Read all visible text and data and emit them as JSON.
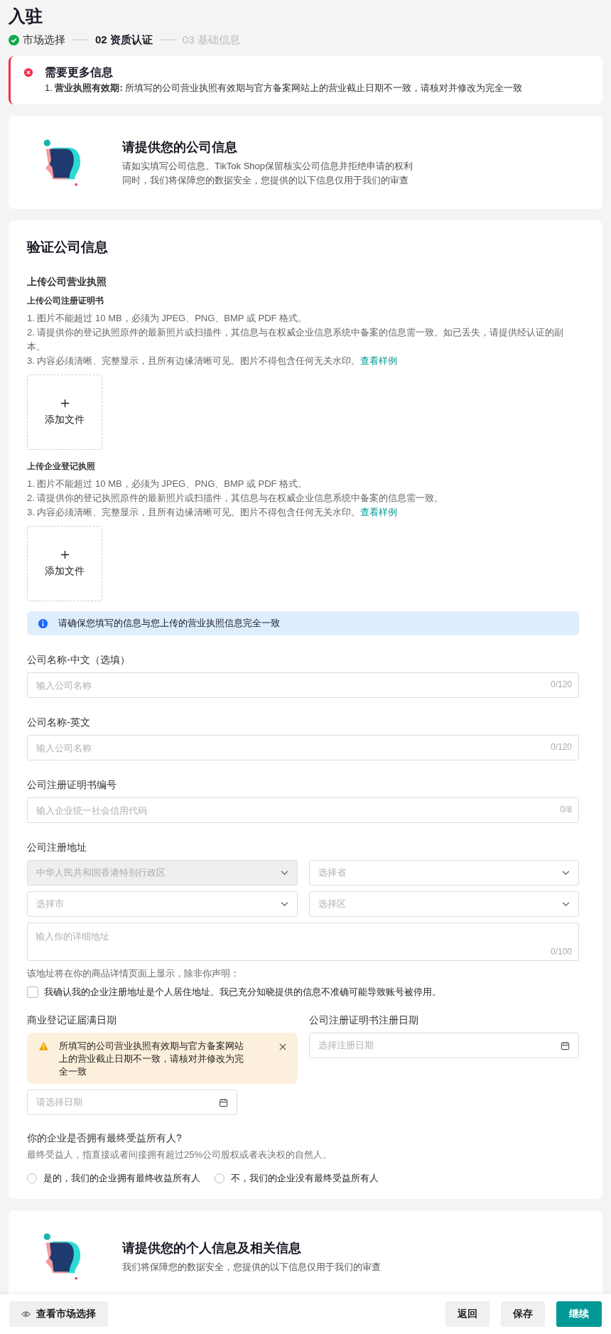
{
  "page_title": "入驻",
  "steps": [
    {
      "label": "市场选择",
      "completed": true,
      "selected": false
    },
    {
      "label": "02 资质认证",
      "completed": false,
      "selected": true
    },
    {
      "label": "03 基础信息",
      "completed": false,
      "selected": false
    }
  ],
  "alert": {
    "title": "需要更多信息",
    "text": "1. **营业执照有效期:** 所填写的公司营业执照有效期与官方备案网站上的营业截止日期不一致，请核对并修改为完全一致"
  },
  "intro_card": {
    "title": "请提供您的公司信息",
    "lines": [
      "请如实填写公司信息。TikTok Shop保留核实公司信息并拒绝申请的权利",
      "同时，我们将保障您的数据安全，您提供的以下信息仅用于我们的审查"
    ]
  },
  "verify": {
    "title": "验证公司信息",
    "section_title": "上传公司营业执照",
    "uploads": [
      {
        "label": "上传公司注册证明书",
        "rules": [
          "1. 图片不能超过 10 MB，必须为 JPEG、PNG、BMP 或 PDF 格式。",
          "2. 请提供你的登记执照原件的最新照片或扫描件，其信息与在权威企业信息系统中备案的信息需一致。如已丢失，请提供经认证的副本。",
          "3. 内容必须清晰、完整显示，且所有边缘清晰可见。图片不得包含任何无关水印。"
        ],
        "link": "查看样例",
        "button": "添加文件"
      },
      {
        "label": "上传企业登记执照",
        "rules": [
          "1. 图片不能超过 10 MB，必须为 JPEG、PNG、BMP 或 PDF 格式。",
          "2. 请提供你的登记执照原件的最新照片或扫描件，其信息与在权威企业信息系统中备案的信息需一致。",
          "3. 内容必须清晰、完整显示，且所有边缘清晰可见。图片不得包含任何无关水印。"
        ],
        "link": "查看样例",
        "button": "添加文件"
      }
    ],
    "info_banner": "请确保您填写的信息与您上传的营业执照信息完全一致",
    "fields": [
      {
        "label": "公司名称-中文（选填）",
        "placeholder": "输入公司名称",
        "counter": "0/120"
      },
      {
        "label": "公司名称-英文",
        "placeholder": "输入公司名称",
        "counter": "0/120"
      },
      {
        "label": "公司注册证明书编号",
        "placeholder": "输入企业统一社会信用代码",
        "counter": "0/8"
      }
    ],
    "address": {
      "label": "公司注册地址",
      "selects": [
        {
          "value": "中华人民共和国香港特别行政区",
          "disabled": true
        },
        {
          "placeholder": "选择省",
          "disabled": false
        },
        {
          "placeholder": "选择市",
          "disabled": false
        },
        {
          "placeholder": "选择区",
          "disabled": false
        }
      ],
      "detail": {
        "placeholder": "输入你的详细地址",
        "counter": "0/100"
      },
      "note": "该地址将在你的商品详情页面上显示，除非你声明：",
      "confirm": {
        "label": "我确认我的企业注册地址是个人居住地址。我已充分知晓提供的信息不准确可能导致账号被停用。",
        "checked": false
      }
    },
    "dates": [
      {
        "label": "商业登记证届满日期",
        "warning": "所填写的公司营业执照有效期与官方备案网站上的营业截止日期不一致，请核对并修改为完全一致",
        "placeholder": "请选择日期"
      },
      {
        "label": "公司注册证明书注册日期",
        "placeholder": "选择注册日期"
      }
    ],
    "owner": {
      "question": "你的企业是否拥有最终受益所有人?",
      "hint": "最终受益人，指直接或者间接拥有超过25%公司股权或者表决权的自然人。",
      "options": [
        {
          "label": "是的，我们的企业拥有最终收益所有人",
          "selected": false
        },
        {
          "label": "不，我们的企业没有最终受益所有人",
          "selected": false
        }
      ]
    }
  },
  "next_card": {
    "title": "请提供您的个人信息及相关信息",
    "subtitle": "我们将保障您的数据安全，您提供的以下信息仅用于我们的审查"
  },
  "footer": {
    "view_button": "查看市场选择",
    "buttons": [
      {
        "label": "返回",
        "kind": "secondary"
      },
      {
        "label": "保存",
        "kind": "secondary"
      },
      {
        "label": "继续",
        "kind": "primary"
      }
    ]
  }
}
